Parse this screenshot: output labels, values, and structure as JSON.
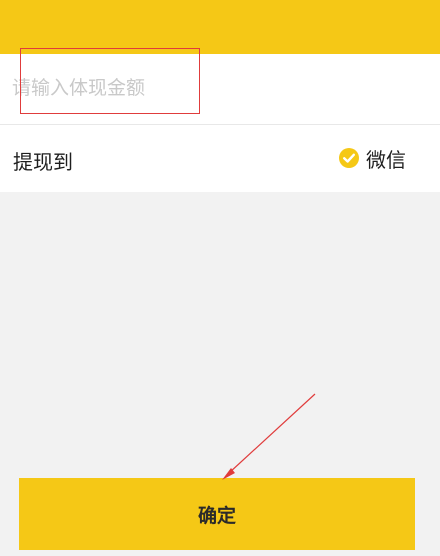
{
  "amount_field": {
    "placeholder": "请输入体现金额",
    "value": ""
  },
  "withdraw": {
    "label": "提现到",
    "method_label": "微信",
    "method_selected": true,
    "method_icon": "check-circle-icon"
  },
  "confirm_button": {
    "label": "确定"
  },
  "colors": {
    "accent": "#f5c816",
    "background": "#f2f2f2",
    "annotation": "#e03c3c"
  }
}
